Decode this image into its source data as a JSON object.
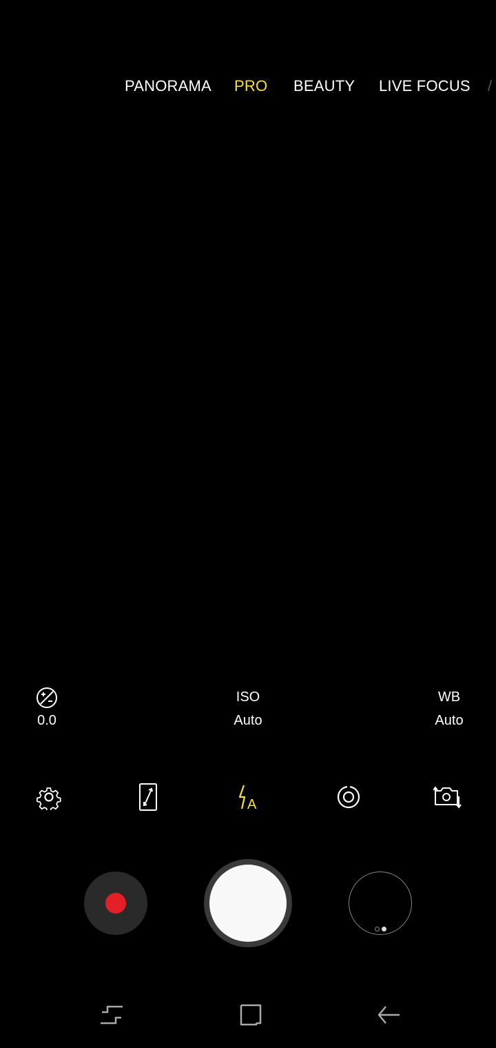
{
  "modes": {
    "items": [
      {
        "label": "PANORAMA",
        "active": false
      },
      {
        "label": "PRO",
        "active": true
      },
      {
        "label": "BEAUTY",
        "active": false
      },
      {
        "label": "LIVE FOCUS",
        "active": false
      }
    ],
    "active_color": "#f5e13a"
  },
  "pro_controls": {
    "exposure": {
      "icon": "exposure-compensation-icon",
      "value": "0.0"
    },
    "iso": {
      "label": "ISO",
      "value": "Auto"
    },
    "wb": {
      "label": "WB",
      "value": "Auto"
    }
  },
  "quick_settings": {
    "icons": [
      "gear-icon",
      "aspect-ratio-icon",
      "flash-auto-icon",
      "effects-icon",
      "switch-camera-icon"
    ],
    "flash_color": "#f5e13a"
  },
  "capture": {
    "record_color": "#e32027"
  },
  "navigation": {
    "icons": [
      "recent-apps-icon",
      "home-icon",
      "back-icon"
    ]
  }
}
